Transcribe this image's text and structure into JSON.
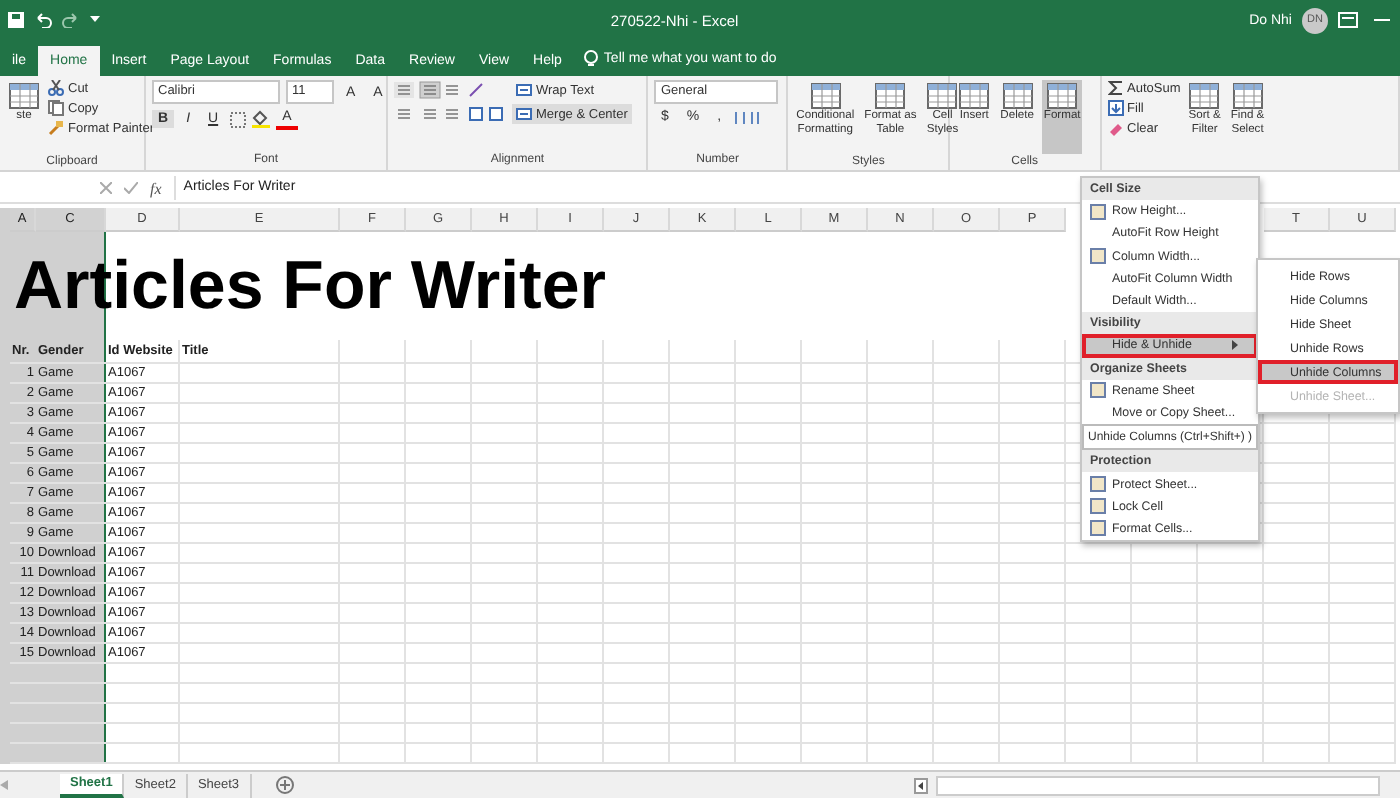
{
  "window": {
    "title": "270522-Nhi  -  Excel",
    "user": "Do Nhi",
    "avatar": "DN"
  },
  "ribbon_tabs": [
    {
      "label": "ile",
      "selected": false
    },
    {
      "label": "Home",
      "selected": true
    },
    {
      "label": "Insert",
      "selected": false
    },
    {
      "label": "Page Layout",
      "selected": false
    },
    {
      "label": "Formulas",
      "selected": false
    },
    {
      "label": "Data",
      "selected": false
    },
    {
      "label": "Review",
      "selected": false
    },
    {
      "label": "View",
      "selected": false
    },
    {
      "label": "Help",
      "selected": false
    }
  ],
  "tell_me": "Tell me what you want to do",
  "ribbon_groups": [
    {
      "name": "Clipboard",
      "controls": [
        {
          "kind": "large",
          "lines": [
            "ste"
          ],
          "selected": false
        },
        {
          "kind": "stack",
          "items": [
            "Cut",
            "Copy",
            "Format Painter"
          ]
        }
      ]
    },
    {
      "name": "Font",
      "controls": [
        {
          "kind": "font",
          "font": "Calibri",
          "size": "11",
          "grow": [
            "A",
            "A"
          ],
          "buttons": [
            "B",
            "I",
            "U"
          ],
          "color_letter": "A"
        }
      ]
    },
    {
      "name": "Alignment",
      "controls": [
        {
          "kind": "align",
          "items": [
            "Wrap Text",
            "Merge & Center"
          ]
        }
      ]
    },
    {
      "name": "Number",
      "controls": [
        {
          "kind": "number",
          "format": "General",
          "symbols": [
            "$",
            "%",
            ","
          ]
        }
      ]
    },
    {
      "name": "Styles",
      "controls": [
        {
          "kind": "large",
          "lines": [
            "Conditional",
            "Formatting"
          ],
          "selected": false
        },
        {
          "kind": "large",
          "lines": [
            "Format as",
            "Table"
          ],
          "selected": false
        },
        {
          "kind": "large",
          "lines": [
            "Cell",
            "Styles"
          ],
          "selected": false
        }
      ]
    },
    {
      "name": "Cells",
      "controls": [
        {
          "kind": "large",
          "lines": [
            "Insert"
          ],
          "selected": false
        },
        {
          "kind": "large",
          "lines": [
            "Delete"
          ],
          "selected": false
        },
        {
          "kind": "large",
          "lines": [
            "Format"
          ],
          "selected": true
        }
      ]
    },
    {
      "controls": [
        {
          "kind": "stack",
          "items": [
            "AutoSum",
            "Fill",
            "Clear"
          ]
        },
        {
          "kind": "large",
          "lines": [
            "Sort &",
            "Filter"
          ],
          "selected": false
        },
        {
          "kind": "large",
          "lines": [
            "Find &",
            "Select"
          ],
          "selected": false
        }
      ]
    }
  ],
  "formula_bar": {
    "function_label": "fx",
    "value": "Articles For Writer"
  },
  "columns": [
    {
      "label": "A",
      "selected": true
    },
    {
      "label": "C",
      "selected": true
    },
    {
      "label": "D",
      "selected": false
    },
    {
      "label": "E",
      "selected": false
    },
    {
      "label": "F",
      "selected": false
    },
    {
      "label": "G",
      "selected": false
    },
    {
      "label": "H",
      "selected": false
    },
    {
      "label": "I",
      "selected": false
    },
    {
      "label": "J",
      "selected": false
    },
    {
      "label": "K",
      "selected": false
    },
    {
      "label": "L",
      "selected": false
    },
    {
      "label": "M",
      "selected": false
    },
    {
      "label": "N",
      "selected": false
    },
    {
      "label": "O",
      "selected": false
    },
    {
      "label": "P",
      "selected": false
    },
    {
      "label": "T",
      "selected": false
    },
    {
      "label": "U",
      "selected": false
    }
  ],
  "sheet_title": "Articles For Writer",
  "table": {
    "headers": [
      "Nr.",
      "Gender",
      "Id Website",
      "Title"
    ],
    "rows": [
      [
        "1",
        "Game",
        "A1067"
      ],
      [
        "2",
        "Game",
        "A1067"
      ],
      [
        "3",
        "Game",
        "A1067"
      ],
      [
        "4",
        "Game",
        "A1067"
      ],
      [
        "5",
        "Game",
        "A1067"
      ],
      [
        "6",
        "Game",
        "A1067"
      ],
      [
        "7",
        "Game",
        "A1067"
      ],
      [
        "8",
        "Game",
        "A1067"
      ],
      [
        "9",
        "Game",
        "A1067"
      ],
      [
        "10",
        "Download",
        "A1067"
      ],
      [
        "11",
        "Download",
        "A1067"
      ],
      [
        "12",
        "Download",
        "A1067"
      ],
      [
        "13",
        "Download",
        "A1067"
      ],
      [
        "14",
        "Download",
        "A1067"
      ],
      [
        "15",
        "Download",
        "A1067"
      ]
    ]
  },
  "sheet_tabs": [
    {
      "label": "Sheet1",
      "selected": true
    },
    {
      "label": "Sheet2",
      "selected": false
    },
    {
      "label": "Sheet3",
      "selected": false
    }
  ],
  "format_menu": [
    {
      "kind": "header",
      "label": "Cell Size"
    },
    {
      "kind": "icon_item",
      "label": "Row Height..."
    },
    {
      "kind": "item",
      "label": "AutoFit Row Height"
    },
    {
      "kind": "icon_item",
      "label": "Column Width..."
    },
    {
      "kind": "item",
      "label": "AutoFit Column Width"
    },
    {
      "kind": "item",
      "label": "Default Width..."
    },
    {
      "kind": "header",
      "label": "Visibility"
    },
    {
      "kind": "submenu",
      "label": "Hide & Unhide",
      "selected": true
    },
    {
      "kind": "header",
      "label": "Organize Sheets"
    },
    {
      "kind": "icon_item",
      "label": "Rename Sheet"
    },
    {
      "kind": "item",
      "label": "Move or Copy Sheet..."
    },
    {
      "kind": "tooltip",
      "label": "Unhide Columns (Ctrl+Shift+) )"
    },
    {
      "kind": "header",
      "label": "Protection"
    },
    {
      "kind": "icon_item",
      "label": "Protect Sheet..."
    },
    {
      "kind": "icon_item",
      "label": "Lock Cell"
    },
    {
      "kind": "icon_item",
      "label": "Format Cells..."
    }
  ],
  "submenu": [
    {
      "label": "Hide Rows",
      "selected": false,
      "disabled": false
    },
    {
      "label": "Hide Columns",
      "selected": false,
      "disabled": false
    },
    {
      "label": "Hide Sheet",
      "selected": false,
      "disabled": false
    },
    {
      "label": "Unhide Rows",
      "selected": false,
      "disabled": false
    },
    {
      "label": "Unhide Columns",
      "selected": true,
      "disabled": false
    },
    {
      "label": "Unhide Sheet...",
      "selected": false,
      "disabled": true
    }
  ]
}
